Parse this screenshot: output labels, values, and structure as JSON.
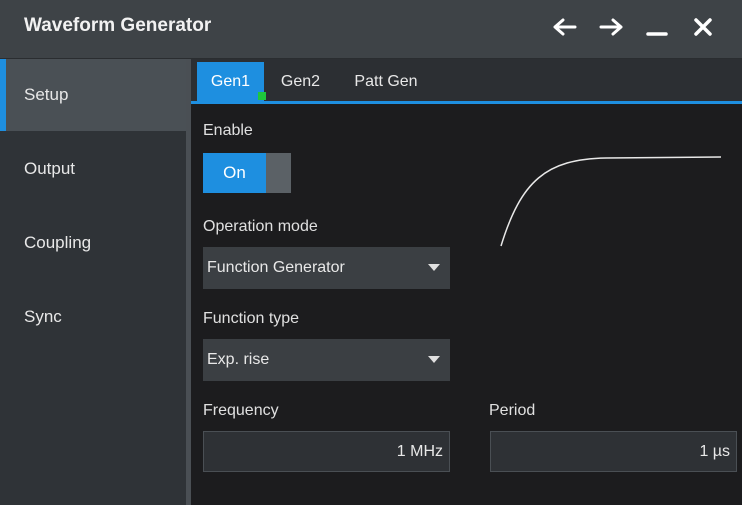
{
  "window": {
    "title": "Waveform Generator"
  },
  "titlebar_icons": [
    "back-arrow-icon",
    "forward-arrow-icon",
    "minimize-icon",
    "close-icon"
  ],
  "sidebar": {
    "items": [
      {
        "label": "Setup",
        "active": true
      },
      {
        "label": "Output",
        "active": false
      },
      {
        "label": "Coupling",
        "active": false
      },
      {
        "label": "Sync",
        "active": false
      }
    ]
  },
  "tabs": [
    {
      "label": "Gen1",
      "active": true,
      "indicator_color": "#1ec83c"
    },
    {
      "label": "Gen2",
      "active": false
    },
    {
      "label": "Patt Gen",
      "active": false
    }
  ],
  "setup": {
    "enable_label": "Enable",
    "enable_value": "On",
    "operation_mode_label": "Operation mode",
    "operation_mode_value": "Function Generator",
    "function_type_label": "Function type",
    "function_type_value": "Exp. rise",
    "frequency_label": "Frequency",
    "frequency_value": "1 MHz",
    "period_label": "Period",
    "period_value": "1 µs"
  },
  "colors": {
    "accent": "#1e8fe0",
    "indicator": "#1ec83c",
    "titlebar": "#3e4347",
    "sidebar": "#2f3337"
  }
}
